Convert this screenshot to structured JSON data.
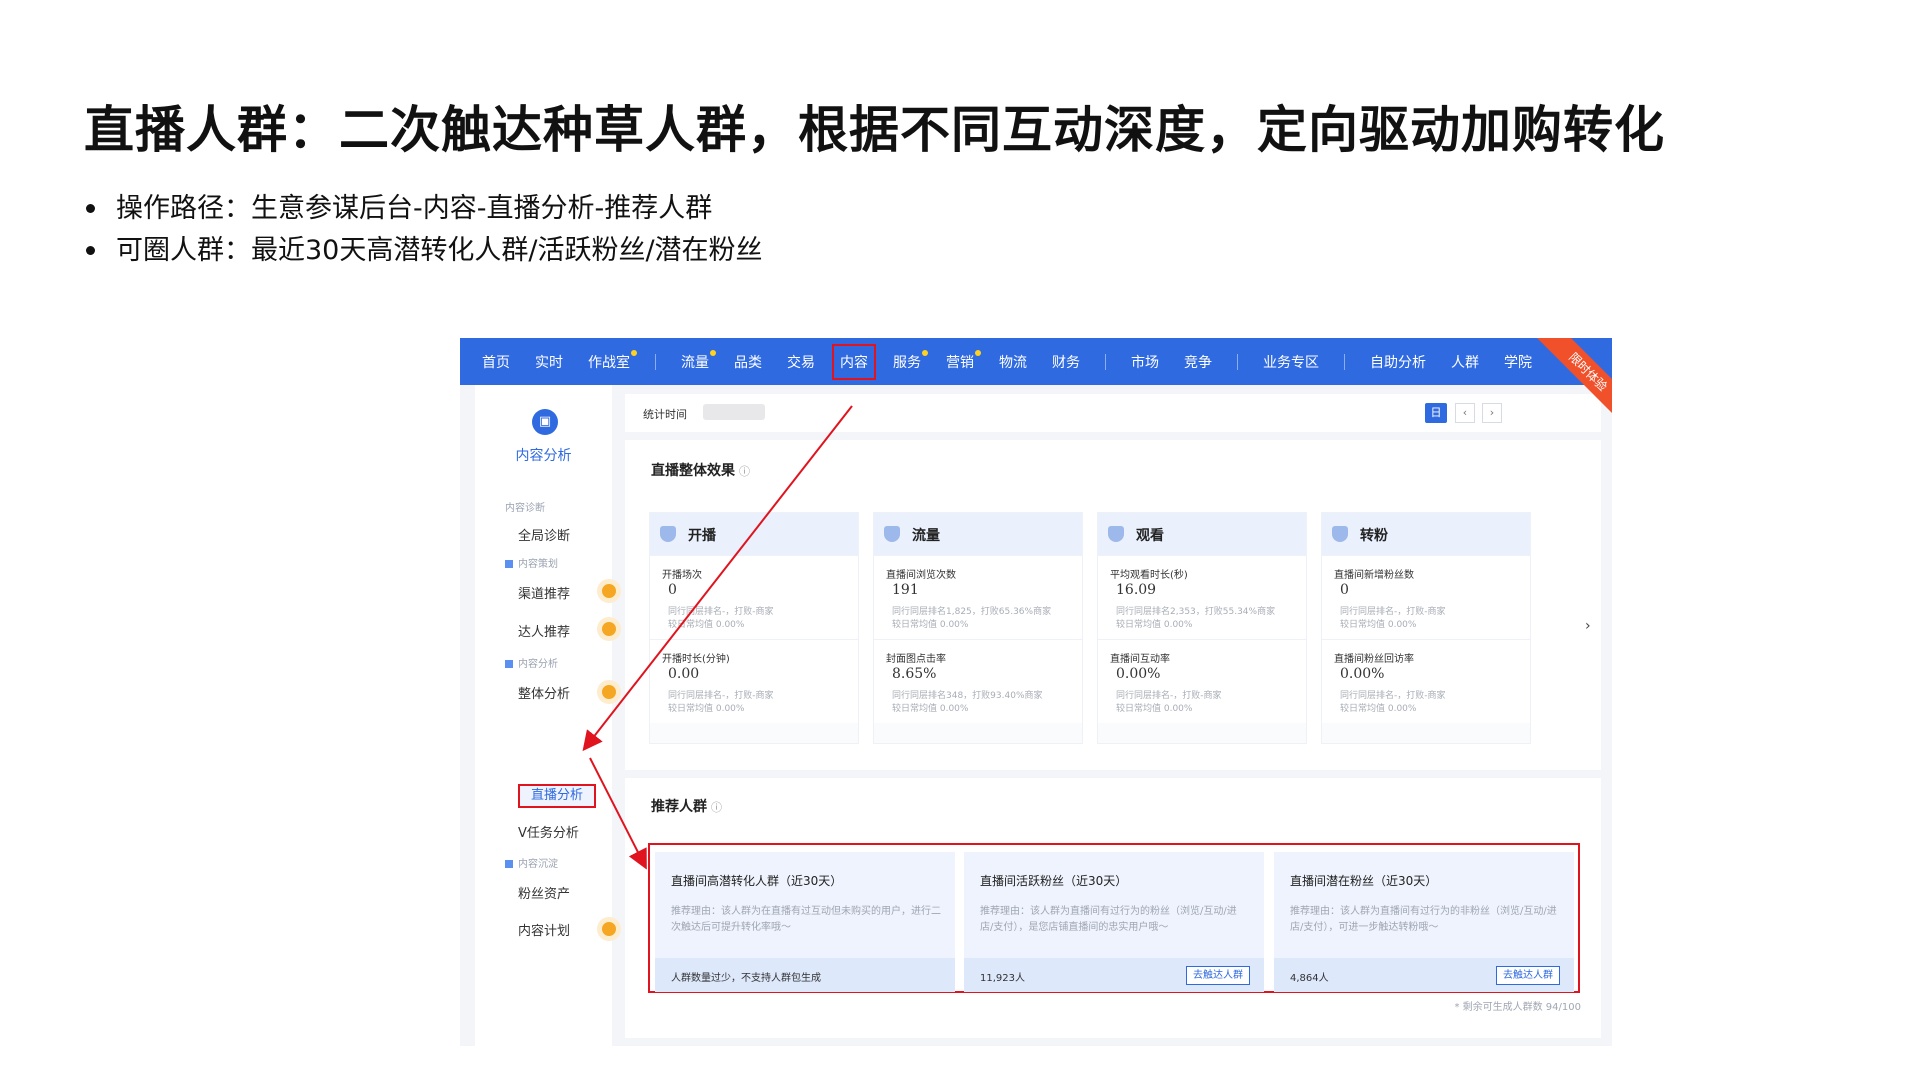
{
  "slide": {
    "title": "直播人群：二次触达种草人群，根据不同互动深度，定向驱动加购转化",
    "bullets": [
      "操作路径：生意参谋后台-内容-直播分析-推荐人群",
      "可圈人群：最近30天高潜转化人群/活跃粉丝/潜在粉丝"
    ]
  },
  "screenshot": {
    "nav": [
      "首页",
      "实时",
      "作战室",
      "流量",
      "品类",
      "交易",
      "内容",
      "服务",
      "营销",
      "物流",
      "财务",
      "市场",
      "竞争",
      "业务专区",
      "自助分析",
      "人群",
      "学院"
    ],
    "sidebar": {
      "title": "内容分析",
      "groups": [
        "内容诊断",
        "内容策划",
        "内容分析",
        "内容沉淀"
      ],
      "items": [
        "全局诊断",
        "渠道推荐",
        "达人推荐",
        "整体分析",
        "直播分析",
        "V任务分析",
        "粉丝资产",
        "内容计划"
      ]
    },
    "stat": {
      "label": "统计时间",
      "day": "日",
      "prev": "‹",
      "next": "›",
      "badge": "限时体验"
    },
    "overview": {
      "title": "直播整体效果",
      "cards": [
        {
          "name": "开播",
          "metrics": [
            {
              "label": "开播场次",
              "value": "0",
              "rank": "同行同层排名-，打败-商家",
              "avg": "较日常均值 0.00%"
            },
            {
              "label": "开播时长(分钟)",
              "value": "0.00",
              "rank": "同行同层排名-，打败-商家",
              "avg": "较日常均值 0.00%"
            }
          ]
        },
        {
          "name": "流量",
          "metrics": [
            {
              "label": "直播间浏览次数",
              "value": "191",
              "rank": "同行同层排名1,825，打败65.36%商家",
              "avg": "较日常均值 0.00%"
            },
            {
              "label": "封面图点击率",
              "value": "8.65%",
              "rank": "同行同层排名348，打败93.40%商家",
              "avg": "较日常均值 0.00%"
            }
          ]
        },
        {
          "name": "观看",
          "metrics": [
            {
              "label": "平均观看时长(秒)",
              "value": "16.09",
              "rank": "同行同层排名2,353，打败55.34%商家",
              "avg": "较日常均值 0.00%"
            },
            {
              "label": "直播间互动率",
              "value": "0.00%",
              "rank": "同行同层排名-，打败-商家",
              "avg": "较日常均值 0.00%"
            }
          ]
        },
        {
          "name": "转粉",
          "metrics": [
            {
              "label": "直播间新增粉丝数",
              "value": "0",
              "rank": "同行同层排名-，打败-商家",
              "avg": "较日常均值 0.00%"
            },
            {
              "label": "直播间粉丝回访率",
              "value": "0.00%",
              "rank": "同行同层排名-，打败-商家",
              "avg": "较日常均值 0.00%"
            }
          ]
        }
      ]
    },
    "recommend": {
      "title": "推荐人群",
      "cards": [
        {
          "title": "直播间高潜转化人群（近30天）",
          "reason": "推荐理由：该人群为在直播有过互动但未购买的用户，进行二次触达后可提升转化率哦～",
          "count": "人群数量过少，不支持人群包生成",
          "button": ""
        },
        {
          "title": "直播间活跃粉丝（近30天）",
          "reason": "推荐理由：该人群为直播间有过行为的粉丝（浏览/互动/进店/支付），是您店铺直播间的忠实用户哦～",
          "count": "11,923人",
          "button": "去触达人群"
        },
        {
          "title": "直播间潜在粉丝（近30天）",
          "reason": "推荐理由：该人群为直播间有过行为的非粉丝（浏览/互动/进店/支付），可进一步触达转粉哦～",
          "count": "4,864人",
          "button": "去触达人群"
        }
      ],
      "remaining": "* 剩余可生成人群数 94/100"
    },
    "colors": {
      "nav": "#2f6ae0",
      "highlight": "#e0141e",
      "badge": "#f0502a"
    }
  }
}
